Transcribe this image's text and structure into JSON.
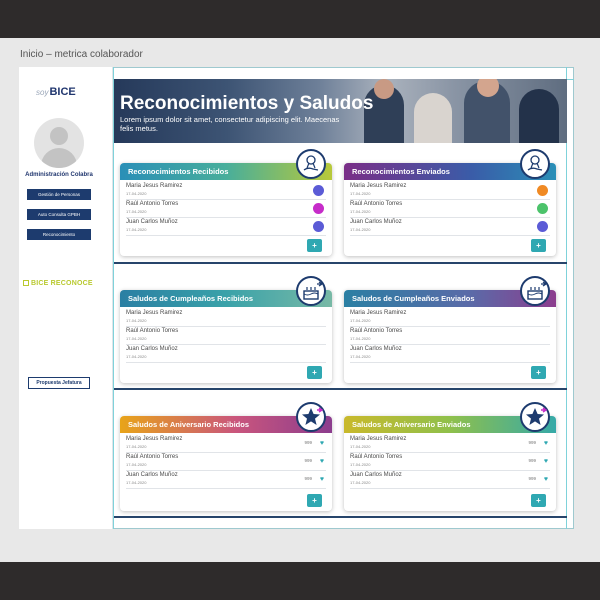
{
  "breadcrumb": "Inicio –  metrica colaborador",
  "colors": {
    "accent": "#2fa8b2",
    "navy": "#1d3b6e"
  },
  "sidebar": {
    "logo_prefix": "soy",
    "logo": "BICE",
    "admin_title": "Administración Colabra",
    "buttons": [
      "Gestión de Personas",
      "Auto Consulta GPBH",
      "Reconocimiento"
    ],
    "brand": "BICE RECONOCE",
    "propuesta": "Propuesta Jefatura"
  },
  "hero": {
    "title": "Reconocimientos y Saludos",
    "subtitle": "Lorem ipsum dolor sit amet, consectetur adipiscing elit. Maecenas felis metus."
  },
  "sections": [
    {
      "cards": [
        {
          "title": "Reconocimientos Recibidos",
          "badge": "medal-hand-icon",
          "rows": [
            {
              "name": "Maria Jesus Ramirez",
              "date": "17-04-2020",
              "icon": "face-icon",
              "icon_color": "#5b5bd6"
            },
            {
              "name": "Raúl Antonio Torres",
              "date": "17-04-2020",
              "icon": "plus-circle-icon",
              "icon_color": "#c62cc9"
            },
            {
              "name": "Juan Carlos Muñoz",
              "date": "17-04-2020",
              "icon": "face-icon",
              "icon_color": "#5b5bd6"
            }
          ]
        },
        {
          "title": "Reconocimientos Enviados",
          "badge": "medal-hand-icon",
          "rows": [
            {
              "name": "Maria Jesus Ramirez",
              "date": "17-04-2020",
              "icon": "wave-icon",
              "icon_color": "#f08a24"
            },
            {
              "name": "Raúl Antonio Torres",
              "date": "17-04-2020",
              "icon": "target-icon",
              "icon_color": "#4cc36b"
            },
            {
              "name": "Juan Carlos Muñoz",
              "date": "17-04-2020",
              "icon": "face-icon",
              "icon_color": "#5b5bd6"
            }
          ]
        }
      ]
    },
    {
      "cards": [
        {
          "title": "Saludos de Cumpleaños Recibidos",
          "badge": "cake-icon",
          "rows": [
            {
              "name": "Maria Jesus Ramirez",
              "date": "17-04-2020"
            },
            {
              "name": "Raúl Antonio Torres",
              "date": "17-04-2020"
            },
            {
              "name": "Juan Carlos Muñoz",
              "date": "17-04-2020"
            }
          ]
        },
        {
          "title": "Saludos de Cumpleaños Enviados",
          "badge": "cake-icon",
          "rows": [
            {
              "name": "Maria Jesus Ramirez",
              "date": "17-04-2020"
            },
            {
              "name": "Raúl Antonio Torres",
              "date": "17-04-2020"
            },
            {
              "name": "Juan Carlos Muñoz",
              "date": "17-04-2020"
            }
          ]
        }
      ]
    },
    {
      "cards": [
        {
          "title": "Saludos de Aniversario Recibidos",
          "badge": "star-icon",
          "rows": [
            {
              "name": "Maria Jesus Ramirez",
              "date": "17-04-2020",
              "count": "999"
            },
            {
              "name": "Raúl Antonio Torres",
              "date": "17-04-2020",
              "count": "999"
            },
            {
              "name": "Juan Carlos Muñoz",
              "date": "17-04-2020",
              "count": "999"
            }
          ]
        },
        {
          "title": "Saludos de Aniversario Enviados",
          "badge": "star-icon",
          "rows": [
            {
              "name": "Maria Jesus Ramirez",
              "date": "17-04-2020",
              "count": "999"
            },
            {
              "name": "Raúl Antonio Torres",
              "date": "17-04-2020",
              "count": "999"
            },
            {
              "name": "Juan Carlos Muñoz",
              "date": "17-04-2020",
              "count": "999"
            }
          ]
        }
      ]
    }
  ],
  "add_label": "+"
}
